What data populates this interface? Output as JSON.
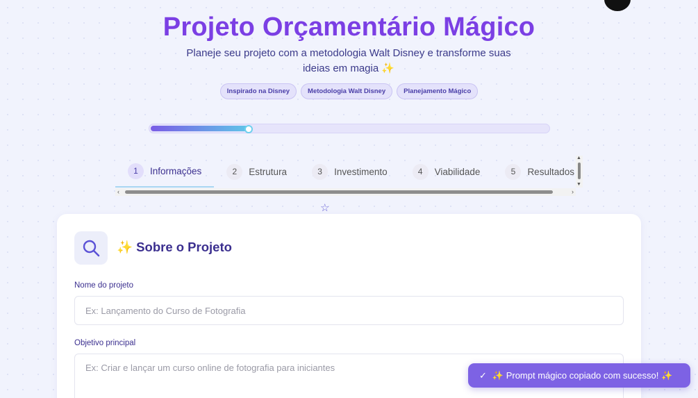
{
  "header": {
    "title": "Projeto Orçamentário Mágico",
    "subtitle": "Planeje seu projeto com a metodologia Walt Disney e transforme suas ideias em magia ✨",
    "badges": [
      "Inspirado na Disney",
      "Metodologia Walt Disney",
      "Planejamento Mágico"
    ]
  },
  "progress": {
    "value_percent": 25
  },
  "tabs": [
    {
      "num": "1",
      "label": "Informações",
      "active": true
    },
    {
      "num": "2",
      "label": "Estrutura",
      "active": false
    },
    {
      "num": "3",
      "label": "Investimento",
      "active": false
    },
    {
      "num": "4",
      "label": "Viabilidade",
      "active": false
    },
    {
      "num": "5",
      "label": "Resultados",
      "active": false
    }
  ],
  "card": {
    "title": "✨ Sobre o Projeto",
    "icon": "search-icon",
    "fields": {
      "name_label": "Nome do projeto",
      "name_placeholder": "Ex: Lançamento do Curso de Fotografia",
      "objective_label": "Objetivo principal",
      "objective_placeholder": "Ex: Criar e lançar um curso online de fotografia para iniciantes"
    }
  },
  "toast": {
    "icon": "check-icon",
    "message": "✨ Prompt mágico copiado com sucesso! ✨"
  },
  "colors": {
    "accent": "#7b3fe4",
    "heading": "#3b2f8f",
    "toast_bg": "#7d62e4",
    "progress_start": "#7a5ce6",
    "progress_end": "#5fc7e8"
  }
}
